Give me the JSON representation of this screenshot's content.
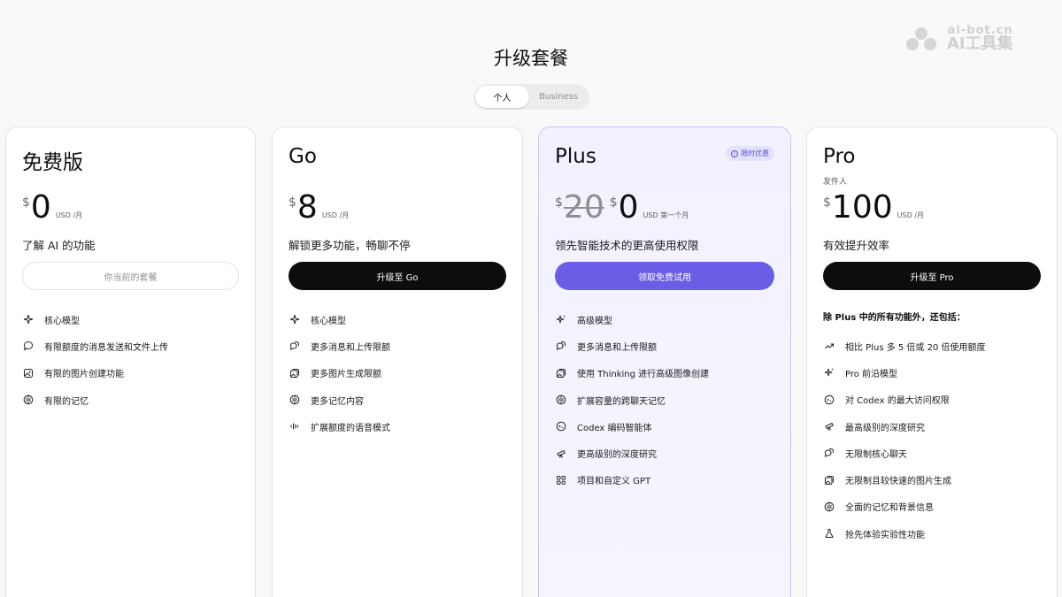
{
  "watermark": {
    "url": "ai-bot.cn",
    "name": "AI工具集"
  },
  "page": {
    "title": "升级套餐"
  },
  "toggle": {
    "personal": "个人",
    "business": "Business"
  },
  "plans": [
    {
      "name": "免费版",
      "currency": "$",
      "price": "0",
      "period": "USD /月",
      "tagline": "了解 AI 的功能",
      "cta": "你当前的套餐",
      "features": [
        {
          "icon": "sparkle-icon",
          "label": "核心模型"
        },
        {
          "icon": "chat-bubble-icon",
          "label": "有限额度的消息发送和文件上传"
        },
        {
          "icon": "image-icon",
          "label": "有限的图片创建功能"
        },
        {
          "icon": "brain-icon",
          "label": "有限的记忆"
        }
      ]
    },
    {
      "name": "Go",
      "currency": "$",
      "price": "8",
      "period": "USD /月",
      "tagline": "解锁更多功能，畅聊不停",
      "cta": "升级至 Go",
      "features": [
        {
          "icon": "sparkle-icon",
          "label": "核心模型"
        },
        {
          "icon": "chat-bubbles-icon",
          "label": "更多消息和上传限额"
        },
        {
          "icon": "images-icon",
          "label": "更多图片生成限额"
        },
        {
          "icon": "brain-icon",
          "label": "更多记忆内容"
        },
        {
          "icon": "voice-wave-icon",
          "label": "扩展额度的语音模式"
        }
      ]
    },
    {
      "name": "Plus",
      "badge": "限时优惠",
      "currency": "$",
      "old_price": "20",
      "price": "0",
      "period": "USD 第一个月",
      "tagline": "领先智能技术的更高使用权限",
      "cta": "领取免费试用",
      "features": [
        {
          "icon": "sparkles-icon",
          "label": "高级模型"
        },
        {
          "icon": "chat-bubbles-icon",
          "label": "更多消息和上传限额"
        },
        {
          "icon": "images-icon",
          "label": "使用 Thinking 进行高级图像创建"
        },
        {
          "icon": "brain-icon",
          "label": "扩展容量的跨聊天记忆"
        },
        {
          "icon": "codex-icon",
          "label": "Codex 编码智能体"
        },
        {
          "icon": "telescope-icon",
          "label": "更高级别的深度研究"
        },
        {
          "icon": "grid-icon",
          "label": "项目和自定义 GPT"
        }
      ]
    },
    {
      "name": "Pro",
      "sub": "发件人",
      "currency": "$",
      "price": "100",
      "period": "USD /月",
      "tagline": "有效提升效率",
      "cta": "升级至 Pro",
      "feature_header": "除 Plus 中的所有功能外，还包括：",
      "features": [
        {
          "icon": "trend-up-icon",
          "label": "相比 Plus 多 5 倍或 20 倍使用额度"
        },
        {
          "icon": "sparkles-icon",
          "label": "Pro 前沿模型"
        },
        {
          "icon": "codex-icon",
          "label": "对 Codex 的最大访问权限"
        },
        {
          "icon": "telescope-icon",
          "label": "最高级别的深度研究"
        },
        {
          "icon": "chat-bubbles-icon",
          "label": "无限制核心聊天"
        },
        {
          "icon": "images-icon",
          "label": "无限制且较快速的图片生成"
        },
        {
          "icon": "brain-icon",
          "label": "全面的记忆和背景信息"
        },
        {
          "icon": "flask-icon",
          "label": "抢先体验实验性功能"
        }
      ]
    }
  ]
}
